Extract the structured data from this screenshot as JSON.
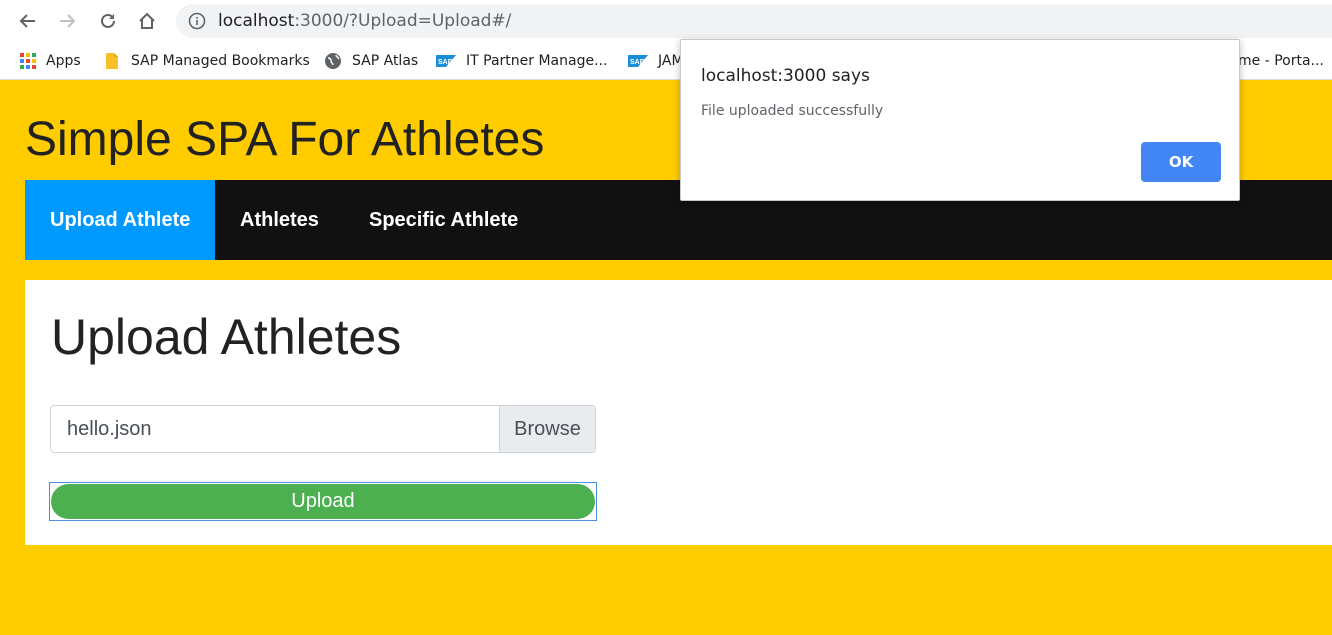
{
  "browser": {
    "url_host": "localhost",
    "url_path": ":3000/?Upload=Upload#/",
    "bookmarks": [
      {
        "label": "Apps",
        "icon": "apps-grid-icon"
      },
      {
        "label": "SAP Managed Bookmarks",
        "icon": "folder-icon"
      },
      {
        "label": "SAP Atlas",
        "icon": "globe-icon"
      },
      {
        "label": "IT Partner Manage...",
        "icon": "sap-logo-icon"
      },
      {
        "label": "JAM",
        "icon": "sap-logo-icon"
      },
      {
        "label": "me - Porta...",
        "icon": ""
      }
    ]
  },
  "page": {
    "title": "Simple SPA For Athletes",
    "tabs": [
      {
        "label": "Upload Athlete",
        "active": true
      },
      {
        "label": "Athletes",
        "active": false
      },
      {
        "label": "Specific Athlete",
        "active": false
      }
    ],
    "section_title": "Upload Athletes",
    "file_value": "hello.json",
    "browse_label": "Browse",
    "upload_label": "Upload"
  },
  "dialog": {
    "title": "localhost:3000 says",
    "message": "File uploaded successfully",
    "ok_label": "OK"
  },
  "colors": {
    "page_bg": "#ffcc00",
    "tab_active": "#0099ff",
    "tabbar_bg": "#111111",
    "upload_btn": "#4caf50",
    "ok_btn": "#4285f4"
  }
}
